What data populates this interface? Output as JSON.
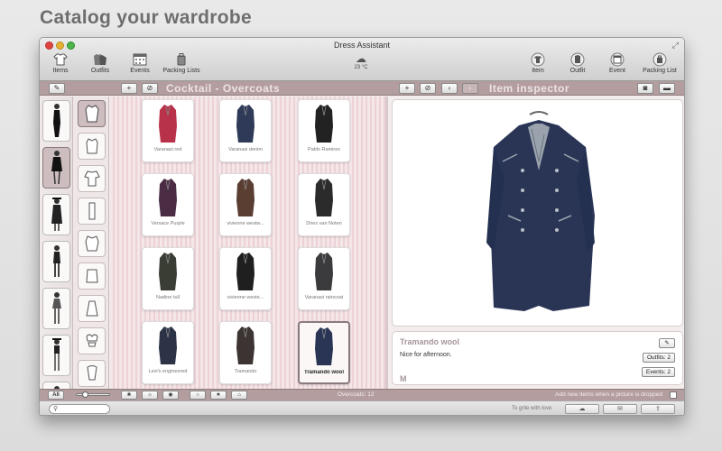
{
  "headline": "Catalog your wardrobe",
  "window": {
    "title": "Dress Assistant"
  },
  "toolbar_left": [
    {
      "label": "Items",
      "icon": "shirt-icon"
    },
    {
      "label": "Outfits",
      "icon": "outfits-icon"
    },
    {
      "label": "Events",
      "icon": "calendar-icon"
    },
    {
      "label": "Packing Lists",
      "icon": "suitcase-icon"
    }
  ],
  "weather": {
    "temp": "23 °C",
    "icon": "cloud-icon"
  },
  "toolbar_right": [
    {
      "label": "Item",
      "icon": "shirt-icon"
    },
    {
      "label": "Outfit",
      "icon": "outfit-icon"
    },
    {
      "label": "Event",
      "icon": "calendar-icon"
    },
    {
      "label": "Packing List",
      "icon": "suitcase-icon"
    }
  ],
  "secondary_bar": {
    "edit_btn": "✎",
    "add_btn": "+",
    "remove_btn": "⊘",
    "collection_title": "Cocktail - Overcoats",
    "inspector_add": "+",
    "inspector_remove": "⊘",
    "prev": "‹",
    "next": "›",
    "inspector_title": "Item inspector",
    "camera_icon": "camera-icon",
    "folder_icon": "folder-icon"
  },
  "items": [
    {
      "label": "Varanasi red",
      "color": "#b8324a"
    },
    {
      "label": "Varanasi denim",
      "color": "#2e3a58"
    },
    {
      "label": "Pablo Ramirez",
      "color": "#222222"
    },
    {
      "label": "Versace Purple",
      "color": "#4a2c44"
    },
    {
      "label": "vivienne westw...",
      "color": "#5a3e32"
    },
    {
      "label": "Dries van Noten",
      "color": "#2b2b2b"
    },
    {
      "label": "Nadine tull",
      "color": "#3a3d34"
    },
    {
      "label": "vivienne weste...",
      "color": "#1f1f1f"
    },
    {
      "label": "Varanasi raincoat",
      "color": "#3b3b3e"
    },
    {
      "label": "Levi's engineered",
      "color": "#2c3346"
    },
    {
      "label": "Tramando",
      "color": "#3c3432"
    },
    {
      "label": "Tramando wool",
      "color": "#2a3556"
    }
  ],
  "inspector": {
    "item_name": "Tramando wool",
    "note": "Nice for afternoon.",
    "size": "M",
    "outfits": "Outfits: 2",
    "events": "Events: 2",
    "edit_icon": "pencil-icon"
  },
  "bottom_bar": {
    "all_btn": "All",
    "count": "Overcoats: 12",
    "add_new_label": "Add new items when a picture is dropped"
  },
  "status_bar": {
    "search_placeholder": "",
    "tagline": "To grile with love"
  }
}
